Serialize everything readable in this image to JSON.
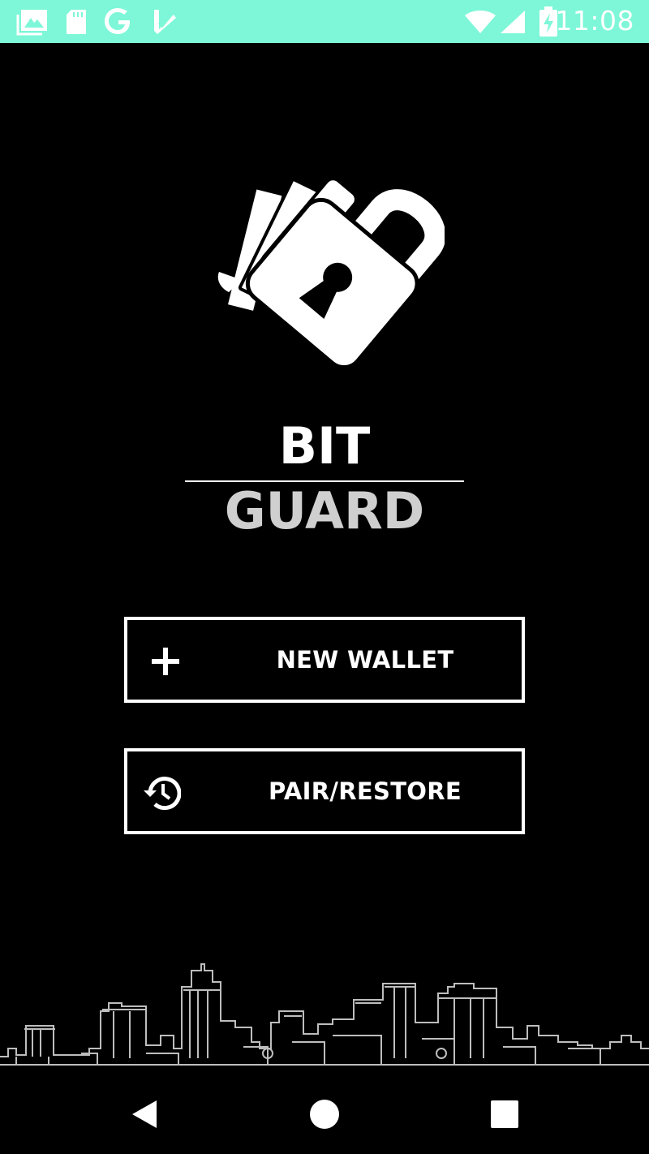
{
  "status_bar": {
    "time": "11:08",
    "background": "#7df7d8",
    "icons": [
      "gallery-icon",
      "sd-card-icon",
      "google-icon",
      "check-icon",
      "wifi-icon",
      "signal-icon",
      "battery-charging-icon"
    ]
  },
  "brand": {
    "word1": "BIT",
    "word2": "GUARD"
  },
  "buttons": {
    "new_wallet": "NEW WALLET",
    "pair_restore": "PAIR/RESTORE"
  },
  "nav": {
    "icons": [
      "back-icon",
      "home-icon",
      "recents-icon"
    ]
  }
}
